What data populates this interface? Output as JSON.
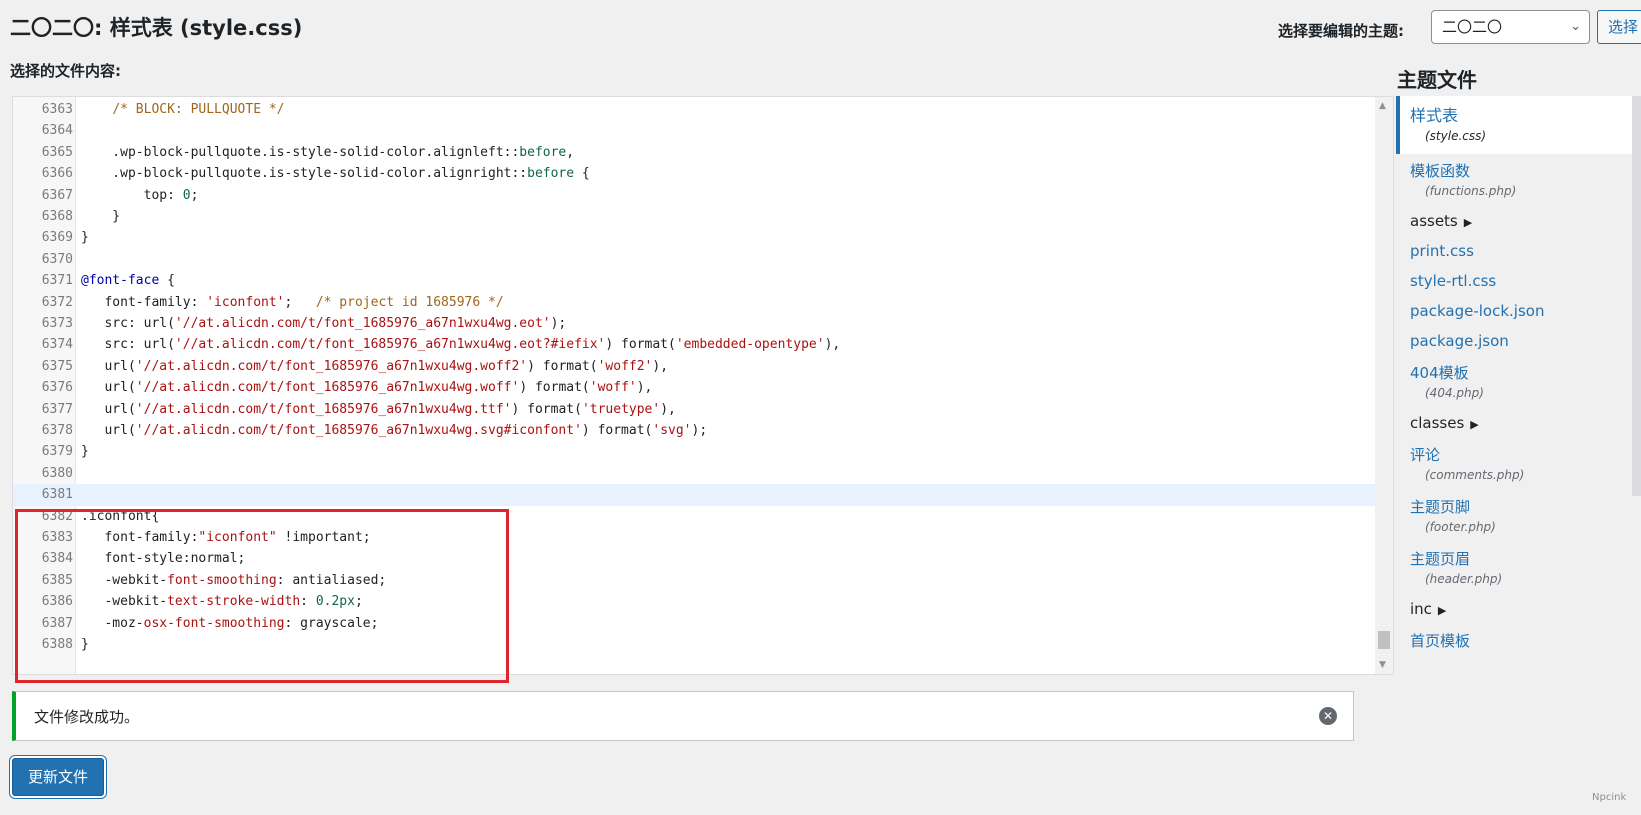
{
  "header": {
    "page_title": "二〇二〇: 样式表 (style.css)",
    "content_label": "选择的文件内容:",
    "theme_select_label": "选择要编辑的主题:",
    "theme_select_value": "二〇二〇",
    "select_button_label": "选择"
  },
  "editor": {
    "lines": [
      {
        "n": "6363",
        "html": "    <span class='tok-comment'>/* BLOCK: PULLQUOTE */</span>"
      },
      {
        "n": "6364",
        "html": ""
      },
      {
        "n": "6365",
        "html": "    .wp-block-pullquote.is-style-solid-color.alignleft::<span class='tok-pseudo'>before</span>,"
      },
      {
        "n": "6366",
        "html": "    .wp-block-pullquote.is-style-solid-color.alignright::<span class='tok-pseudo'>before</span> {"
      },
      {
        "n": "6367",
        "html": "        top: <span class='tok-num'>0</span>;"
      },
      {
        "n": "6368",
        "html": "    }"
      },
      {
        "n": "6369",
        "html": "}"
      },
      {
        "n": "6370",
        "html": ""
      },
      {
        "n": "6371",
        "html": "<span class='tok-def'>@font-face</span> {"
      },
      {
        "n": "6372",
        "html": "   font-family: <span class='tok-string'>'iconfont'</span>;   <span class='tok-comment'>/* project id 1685976 */</span>"
      },
      {
        "n": "6373",
        "html": "   src: url(<span class='tok-string'>'//at.alicdn.com/t/font_1685976_a67n1wxu4wg.eot'</span>);"
      },
      {
        "n": "6374",
        "html": "   src: url(<span class='tok-string'>'//at.alicdn.com/t/font_1685976_a67n1wxu4wg.eot?#iefix'</span>) format(<span class='tok-string'>'embedded-opentype'</span>),"
      },
      {
        "n": "6375",
        "html": "   url(<span class='tok-string'>'//at.alicdn.com/t/font_1685976_a67n1wxu4wg.woff2'</span>) format(<span class='tok-string'>'woff2'</span>),"
      },
      {
        "n": "6376",
        "html": "   url(<span class='tok-string'>'//at.alicdn.com/t/font_1685976_a67n1wxu4wg.woff'</span>) format(<span class='tok-string'>'woff'</span>),"
      },
      {
        "n": "6377",
        "html": "   url(<span class='tok-string'>'//at.alicdn.com/t/font_1685976_a67n1wxu4wg.ttf'</span>) format(<span class='tok-string'>'truetype'</span>),"
      },
      {
        "n": "6378",
        "html": "   url(<span class='tok-string'>'//at.alicdn.com/t/font_1685976_a67n1wxu4wg.svg#iconfont'</span>) format(<span class='tok-string'>'svg'</span>);"
      },
      {
        "n": "6379",
        "html": "}"
      },
      {
        "n": "6380",
        "html": ""
      },
      {
        "n": "6381",
        "html": "",
        "active": true
      },
      {
        "n": "6382",
        "html": ".iconfont{"
      },
      {
        "n": "6383",
        "html": "   font-family:<span class='tok-string'>\"iconfont\"</span> !important;"
      },
      {
        "n": "6384",
        "html": "   font-style:normal;"
      },
      {
        "n": "6385",
        "html": "   -webkit-<span class='tok-prop'>font-smoothing</span>: antialiased;"
      },
      {
        "n": "6386",
        "html": "   -webkit-<span class='tok-prop'>text-stroke-width</span>: <span class='tok-num'>0.2px</span>;"
      },
      {
        "n": "6387",
        "html": "   -moz-<span class='tok-prop'>osx-font-smoothing</span>: grayscale;"
      },
      {
        "n": "6388",
        "html": "}"
      }
    ]
  },
  "sidebar": {
    "title": "主题文件",
    "items": [
      {
        "name": "样式表",
        "sub": "(style.css)",
        "active": true
      },
      {
        "name": "模板函数",
        "sub": "(functions.php)"
      },
      {
        "name": "assets",
        "folder": true
      },
      {
        "name": "print.css"
      },
      {
        "name": "style-rtl.css"
      },
      {
        "name": "package-lock.json"
      },
      {
        "name": "package.json"
      },
      {
        "name": "404模板",
        "sub": "(404.php)"
      },
      {
        "name": "classes",
        "folder": true
      },
      {
        "name": "评论",
        "sub": "(comments.php)"
      },
      {
        "name": "主题页脚",
        "sub": "(footer.php)"
      },
      {
        "name": "主题页眉",
        "sub": "(header.php)"
      },
      {
        "name": "inc",
        "folder": true
      },
      {
        "name": "首页模板"
      }
    ]
  },
  "notice": {
    "text": "文件修改成功。",
    "accent": "#00a32a"
  },
  "update_button_label": "更新文件",
  "watermark": "Npcink",
  "colors": {
    "primary": "#2271b1",
    "highlight": "#e0242b"
  }
}
